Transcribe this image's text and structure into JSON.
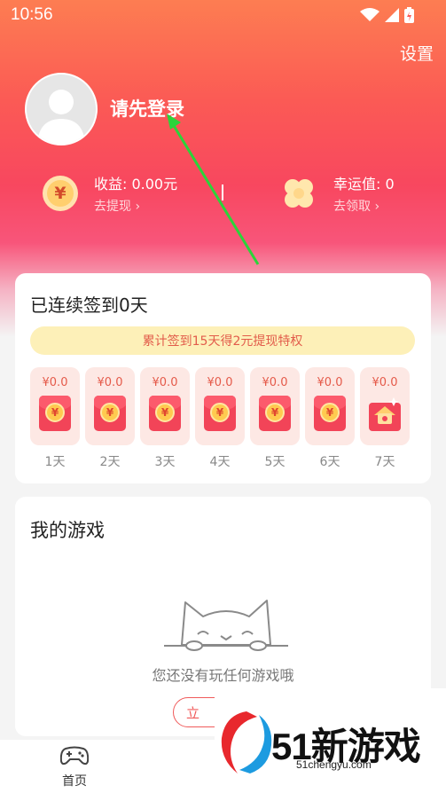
{
  "status_bar": {
    "time": "10:56"
  },
  "header": {
    "settings_label": "设置",
    "login_label": "请先登录",
    "earnings": {
      "value_text": "收益: 0.00元",
      "action": "去提现"
    },
    "luck": {
      "value_text": "幸运值: 0",
      "action": "去领取"
    }
  },
  "checkin": {
    "title": "已连续签到0天",
    "banner": "累计签到15天得2元提现特权",
    "days": [
      {
        "amount": "¥0.0",
        "label": "1天"
      },
      {
        "amount": "¥0.0",
        "label": "2天"
      },
      {
        "amount": "¥0.0",
        "label": "3天"
      },
      {
        "amount": "¥0.0",
        "label": "4天"
      },
      {
        "amount": "¥0.0",
        "label": "5天"
      },
      {
        "amount": "¥0.0",
        "label": "6天"
      },
      {
        "amount": "¥0.0",
        "label": "7天"
      }
    ]
  },
  "my_games": {
    "title": "我的游戏",
    "empty_text": "您还没有玩任何游戏哦",
    "button_label": "立"
  },
  "tabbar": {
    "home_label": "首页"
  },
  "watermark": {
    "brand": "51新游戏",
    "url": "51chengyu.com"
  },
  "colors": {
    "accent": "#f8475f",
    "gold": "#ffcf6e",
    "envelope": "#f24458"
  },
  "icons": [
    "wifi-icon",
    "signal-icon",
    "battery-icon",
    "avatar-icon",
    "yuan-icon",
    "clover-icon",
    "red-envelope-icon",
    "gift-icon",
    "sleeping-cat-icon",
    "gamepad-icon"
  ]
}
